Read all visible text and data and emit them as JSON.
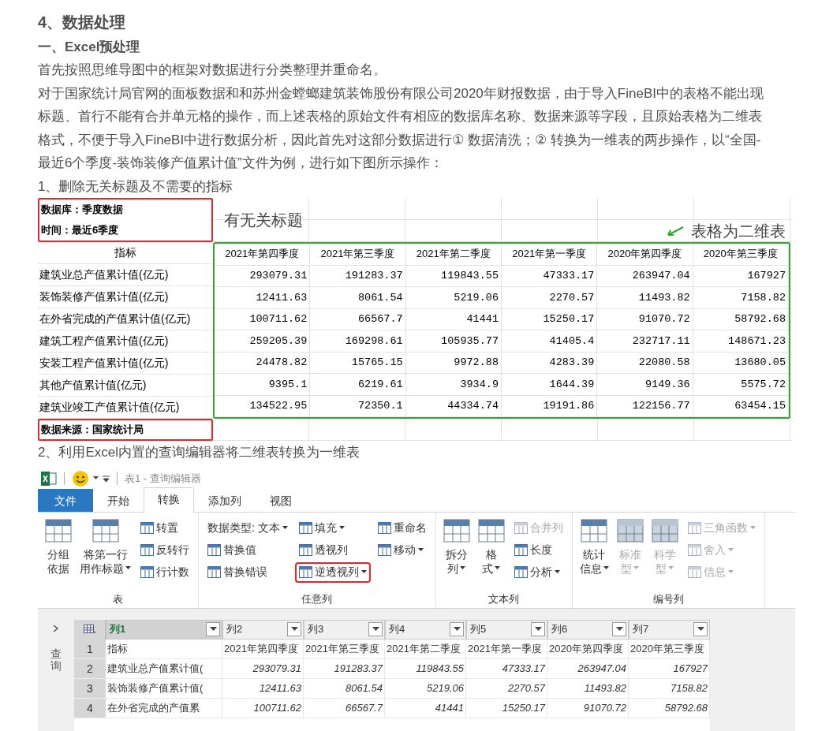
{
  "heading": "4、数据处理",
  "subheading": "一、Excel预处理",
  "paragraphs": [
    "首先按照思维导图中的框架对数据进行分类整理并重命名。",
    "对于国家统计局官网的面板数据和和苏州金螳螂建筑装饰股份有限公司2020年财报数据，由于导入FineBI中的表格不能出现标题、首行不能有合并单元格的操作，而上述表格的原始文件有相应的数据库名称、数据来源等字段，且原始表格为二维表格式，不便于导入FineBI中进行数据分析，因此首先对这部分数据进行① 数据清洗；② 转换为一维表的两步操作，以“全国-最近6个季度-装饰装修产值累计值”文件为例，进行如下图所示操作："
  ],
  "step1": "1、删除无关标题及不需要的指标",
  "sheet": {
    "notes": [
      "数据库：季度数据",
      "时间：最近6季度"
    ],
    "annotation_left": "有无关标题",
    "annotation_right": "表格为二维表",
    "header_label": "指标",
    "columns": [
      "2021年第四季度",
      "2021年第三季度",
      "2021年第二季度",
      "2021年第一季度",
      "2020年第四季度",
      "2020年第三季度"
    ],
    "rows": [
      {
        "label": "建筑业总产值累计值(亿元)",
        "values": [
          "293079.31",
          "191283.37",
          "119843.55",
          "47333.17",
          "263947.04",
          "167927"
        ]
      },
      {
        "label": "装饰装修产值累计值(亿元)",
        "values": [
          "12411.63",
          "8061.54",
          "5219.06",
          "2270.57",
          "11493.82",
          "7158.82"
        ]
      },
      {
        "label": "在外省完成的产值累计值(亿元)",
        "values": [
          "100711.62",
          "66567.7",
          "41441",
          "15250.17",
          "91070.72",
          "58792.68"
        ]
      },
      {
        "label": "建筑工程产值累计值(亿元)",
        "values": [
          "259205.39",
          "169298.61",
          "105935.77",
          "41405.4",
          "232717.11",
          "148671.23"
        ]
      },
      {
        "label": "安装工程产值累计值(亿元)",
        "values": [
          "24478.82",
          "15765.15",
          "9972.88",
          "4283.39",
          "22080.58",
          "13680.05"
        ]
      },
      {
        "label": "其他产值累计值(亿元)",
        "values": [
          "9395.1",
          "6219.61",
          "3934.9",
          "1644.39",
          "9149.36",
          "5575.72"
        ]
      },
      {
        "label": "建筑业竣工产值累计值(亿元)",
        "values": [
          "134522.95",
          "72350.1",
          "44334.74",
          "19191.86",
          "122156.77",
          "63454.15"
        ]
      }
    ],
    "source": "数据来源：国家统计局"
  },
  "step2": "2、利用Excel内置的查询编辑器将二维表转换为一维表",
  "editor": {
    "title": "表1 - 查询编辑器",
    "tabs": [
      {
        "label": "文件",
        "kind": "file",
        "selected": false
      },
      {
        "label": "开始",
        "kind": "tab",
        "selected": false
      },
      {
        "label": "转换",
        "kind": "tab",
        "selected": true
      },
      {
        "label": "添加列",
        "kind": "tab",
        "selected": false
      },
      {
        "label": "视图",
        "kind": "tab",
        "selected": false
      }
    ],
    "groups": [
      {
        "label": "表",
        "large": [
          {
            "lines": [
              "分组",
              "依据"
            ],
            "dropdown": false,
            "disabled": false
          },
          {
            "lines": [
              "将第一行",
              "用作标题"
            ],
            "dropdown": true,
            "disabled": false
          }
        ],
        "columns": [
          [
            {
              "label": "转置",
              "kind": "icon",
              "dropdown": false,
              "disabled": false,
              "highlighted": false
            },
            {
              "label": "反转行",
              "kind": "icon",
              "dropdown": false,
              "disabled": false,
              "highlighted": false
            },
            {
              "label": "行计数",
              "kind": "icon",
              "dropdown": false,
              "disabled": false,
              "highlighted": false
            }
          ]
        ]
      },
      {
        "label": "任意列",
        "columns": [
          [
            {
              "label": "数据类型: 文本",
              "kind": "text",
              "dropdown": true,
              "disabled": false,
              "highlighted": false
            },
            {
              "label": "替换值",
              "kind": "icon",
              "dropdown": false,
              "disabled": false,
              "highlighted": false
            },
            {
              "label": "替换错误",
              "kind": "icon",
              "dropdown": false,
              "disabled": false,
              "highlighted": false
            }
          ],
          [
            {
              "label": "填充",
              "kind": "icon",
              "dropdown": true,
              "disabled": false,
              "highlighted": false
            },
            {
              "label": "透视列",
              "kind": "icon",
              "dropdown": false,
              "disabled": false,
              "highlighted": false
            },
            {
              "label": "逆透视列",
              "kind": "icon",
              "dropdown": true,
              "disabled": false,
              "highlighted": true
            }
          ],
          [
            {
              "label": "重命名",
              "kind": "icon",
              "dropdown": false,
              "disabled": false,
              "highlighted": false
            },
            {
              "label": "移动",
              "kind": "icon",
              "dropdown": true,
              "disabled": false,
              "highlighted": false
            }
          ]
        ]
      },
      {
        "label": "文本列",
        "large": [
          {
            "lines": [
              "拆分",
              "列"
            ],
            "dropdown": true,
            "disabled": false
          },
          {
            "lines": [
              "格",
              "式"
            ],
            "dropdown": true,
            "disabled": false
          }
        ],
        "columns": [
          [
            {
              "label": "合并列",
              "kind": "icon",
              "dropdown": false,
              "disabled": true,
              "highlighted": false
            },
            {
              "label": "长度",
              "kind": "icon",
              "dropdown": false,
              "disabled": false,
              "highlighted": false
            },
            {
              "label": "分析",
              "kind": "icon",
              "dropdown": true,
              "disabled": false,
              "highlighted": false
            }
          ]
        ]
      },
      {
        "label": "编号列",
        "large": [
          {
            "lines": [
              "统计",
              "信息"
            ],
            "dropdown": true,
            "disabled": false
          },
          {
            "lines": [
              "标准",
              "型"
            ],
            "dropdown": true,
            "disabled": true
          },
          {
            "lines": [
              "科学",
              "型"
            ],
            "dropdown": true,
            "disabled": true
          }
        ],
        "columns": [
          [
            {
              "label": "三角函数",
              "kind": "icon",
              "dropdown": true,
              "disabled": true,
              "highlighted": false
            },
            {
              "label": "舍入",
              "kind": "icon",
              "dropdown": true,
              "disabled": true,
              "highlighted": false
            },
            {
              "label": "信息",
              "kind": "icon",
              "dropdown": true,
              "disabled": true,
              "highlighted": false
            }
          ]
        ]
      }
    ],
    "side_label": "查询",
    "grid_columns": [
      {
        "label": "列1",
        "selected": true
      },
      {
        "label": "列2",
        "selected": false
      },
      {
        "label": "列3",
        "selected": false
      },
      {
        "label": "列4",
        "selected": false
      },
      {
        "label": "列5",
        "selected": false
      },
      {
        "label": "列6",
        "selected": false
      },
      {
        "label": "列7",
        "selected": false
      }
    ],
    "grid_rows": [
      {
        "num": "1",
        "kind": "text",
        "cells": [
          "指标",
          "2021年第四季度",
          "2021年第三季度",
          "2021年第二季度",
          "2021年第一季度",
          "2020年第四季度",
          "2020年第三季度"
        ]
      },
      {
        "num": "2",
        "kind": "number",
        "cells": [
          "建筑业总产值累计值(",
          "293079.31",
          "191283.37",
          "119843.55",
          "47333.17",
          "263947.04",
          "167927"
        ]
      },
      {
        "num": "3",
        "kind": "number",
        "cells": [
          "装饰装修产值累计值(",
          "12411.63",
          "8061.54",
          "5219.06",
          "2270.57",
          "11493.82",
          "7158.82"
        ]
      },
      {
        "num": "4",
        "kind": "number",
        "cells": [
          "在外省完成的产值累",
          "100711.62",
          "66567.7",
          "41441",
          "15250.17",
          "91070.72",
          "58792.68"
        ]
      }
    ]
  }
}
